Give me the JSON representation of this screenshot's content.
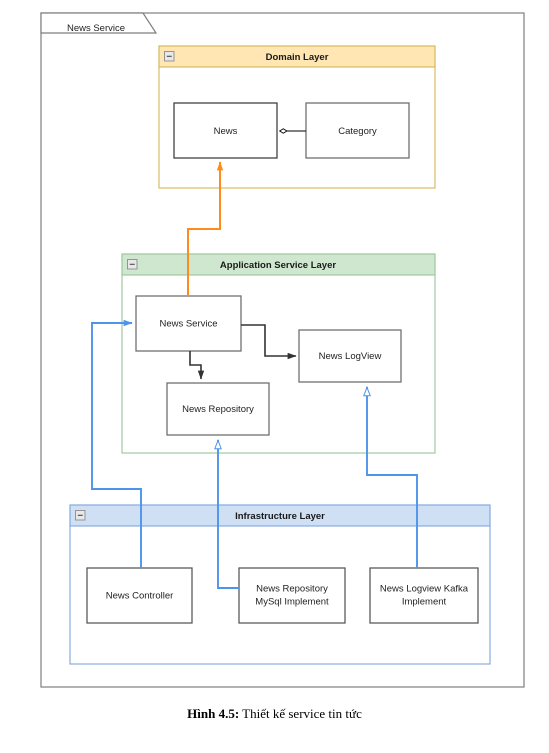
{
  "figure": {
    "caption_label": "Hình 4.5:",
    "caption_text": " Thiết kế service tin tức"
  },
  "package": {
    "tab_label": "News Service",
    "border_color": "#7f7f7f",
    "background": "#ffffff"
  },
  "layers": [
    {
      "id": "domain",
      "title": "Domain Layer",
      "header_fill": "#ffe6b3",
      "border_color": "#d6b656",
      "body_fill": "#ffffff",
      "collapse_icon": "minus-box-icon"
    },
    {
      "id": "application",
      "title": "Application Service Layer",
      "header_fill": "#cfe7cf",
      "border_color": "#9ac49a",
      "body_fill": "#ffffff",
      "collapse_icon": "minus-box-icon"
    },
    {
      "id": "infrastructure",
      "title": "Infrastructure Layer",
      "header_fill": "#cfe0f5",
      "border_color": "#7ea6dd",
      "body_fill": "#ffffff",
      "collapse_icon": "minus-box-icon"
    }
  ],
  "nodes": {
    "news": {
      "label": "News",
      "layer": "domain"
    },
    "category": {
      "label": "Category",
      "layer": "domain"
    },
    "news_service": {
      "label": "News Service",
      "layer": "application"
    },
    "news_logview": {
      "label": "News LogView",
      "layer": "application"
    },
    "news_repository": {
      "label": "News Repository",
      "layer": "application"
    },
    "news_controller": {
      "label": "News Controller",
      "layer": "infrastructure"
    },
    "news_repository_mysql": {
      "label_line1": "News Repository",
      "label_line2": "MySql Implement",
      "layer": "infrastructure"
    },
    "news_logview_kafka": {
      "label_line1": "News Logview Kafka",
      "label_line2": "Implement",
      "layer": "infrastructure"
    }
  },
  "connectors": [
    {
      "id": "news-category-aggregation",
      "from": "category",
      "to": "news",
      "style": "aggregation",
      "color": "#000000",
      "marker": "open-diamond"
    },
    {
      "id": "news-service-to-news",
      "from": "news_service",
      "to": "news",
      "style": "dependency",
      "color": "#ff8c1a",
      "marker": "filled-arrow"
    },
    {
      "id": "news-service-to-logview",
      "from": "news_service",
      "to": "news_logview",
      "style": "dependency",
      "color": "#333333",
      "marker": "filled-arrow"
    },
    {
      "id": "news-service-to-repository",
      "from": "news_service",
      "to": "news_repository",
      "style": "dependency",
      "color": "#333333",
      "marker": "filled-arrow"
    },
    {
      "id": "controller-to-news-service",
      "from": "news_controller",
      "to": "news_service",
      "style": "dependency",
      "color": "#4d94eb",
      "marker": "filled-arrow"
    },
    {
      "id": "mysql-implements-repository",
      "from": "news_repository_mysql",
      "to": "news_repository",
      "style": "realization",
      "color": "#4d94eb",
      "marker": "hollow-triangle"
    },
    {
      "id": "kafka-implements-logview",
      "from": "news_logview_kafka",
      "to": "news_logview",
      "style": "realization",
      "color": "#4d94eb",
      "marker": "hollow-triangle"
    }
  ]
}
